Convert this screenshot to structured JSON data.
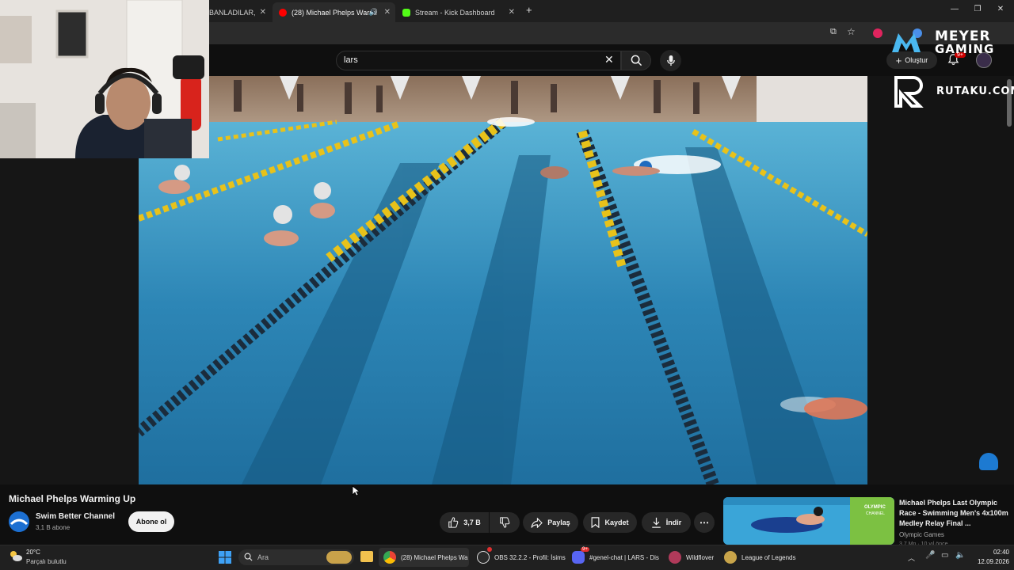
{
  "browser": {
    "tabs": [
      {
        "label": "BANLADILAR, "
      },
      {
        "label": "(28) Michael Phelps Warmi"
      },
      {
        "label": "Stream - Kick Dashboard"
      }
    ],
    "new_tab": "+"
  },
  "youtube": {
    "search": {
      "value": "lars"
    },
    "create_label": "Oluştur",
    "notifications_badge": "9+"
  },
  "overlay": {
    "brand_line1": "MEYER",
    "brand_line2": "GAMING",
    "sponsor": "RUTAKU.COM"
  },
  "video": {
    "title": "Michael Phelps Warming Up",
    "channel": {
      "name": "Swim Better Channel",
      "subscribers": "3,1 B abone"
    },
    "subscribe_label": "Abone ol",
    "actions": {
      "likes": "3,7 B",
      "share": "Paylaş",
      "save": "Kaydet",
      "download": "İndir",
      "more": "⋯"
    }
  },
  "recommendation": {
    "title": "Michael Phelps Last Olympic Race - Swimming Men's 4x100m Medley Relay Final ...",
    "channel": "Olympic Games",
    "meta": "3,7 Mn · 10 yıl önce",
    "thumb_logo": "OLYMPIC",
    "thumb_logo_sub": "CHANNEL"
  },
  "taskbar": {
    "weather": {
      "temp": "20°C",
      "desc": "Parçalı bulutlu"
    },
    "search_placeholder": "Ara",
    "apps": [
      {
        "label": "(28) Michael Phelps Wa"
      },
      {
        "label": "OBS 32.2.2 - Profil: İsims"
      },
      {
        "label": "#genel-chat | LARS - Dis"
      },
      {
        "label": "Wildflover"
      },
      {
        "label": "League of Legends"
      }
    ],
    "discord_badge": "9+",
    "clock": {
      "time": "02:40",
      "date": "12.09.2026"
    }
  },
  "colors": {
    "youtube_red": "#ff0000",
    "kick_green": "#53fc18",
    "pool_blue": "#2f8ab8",
    "lane_yellow": "#e8c21a"
  }
}
